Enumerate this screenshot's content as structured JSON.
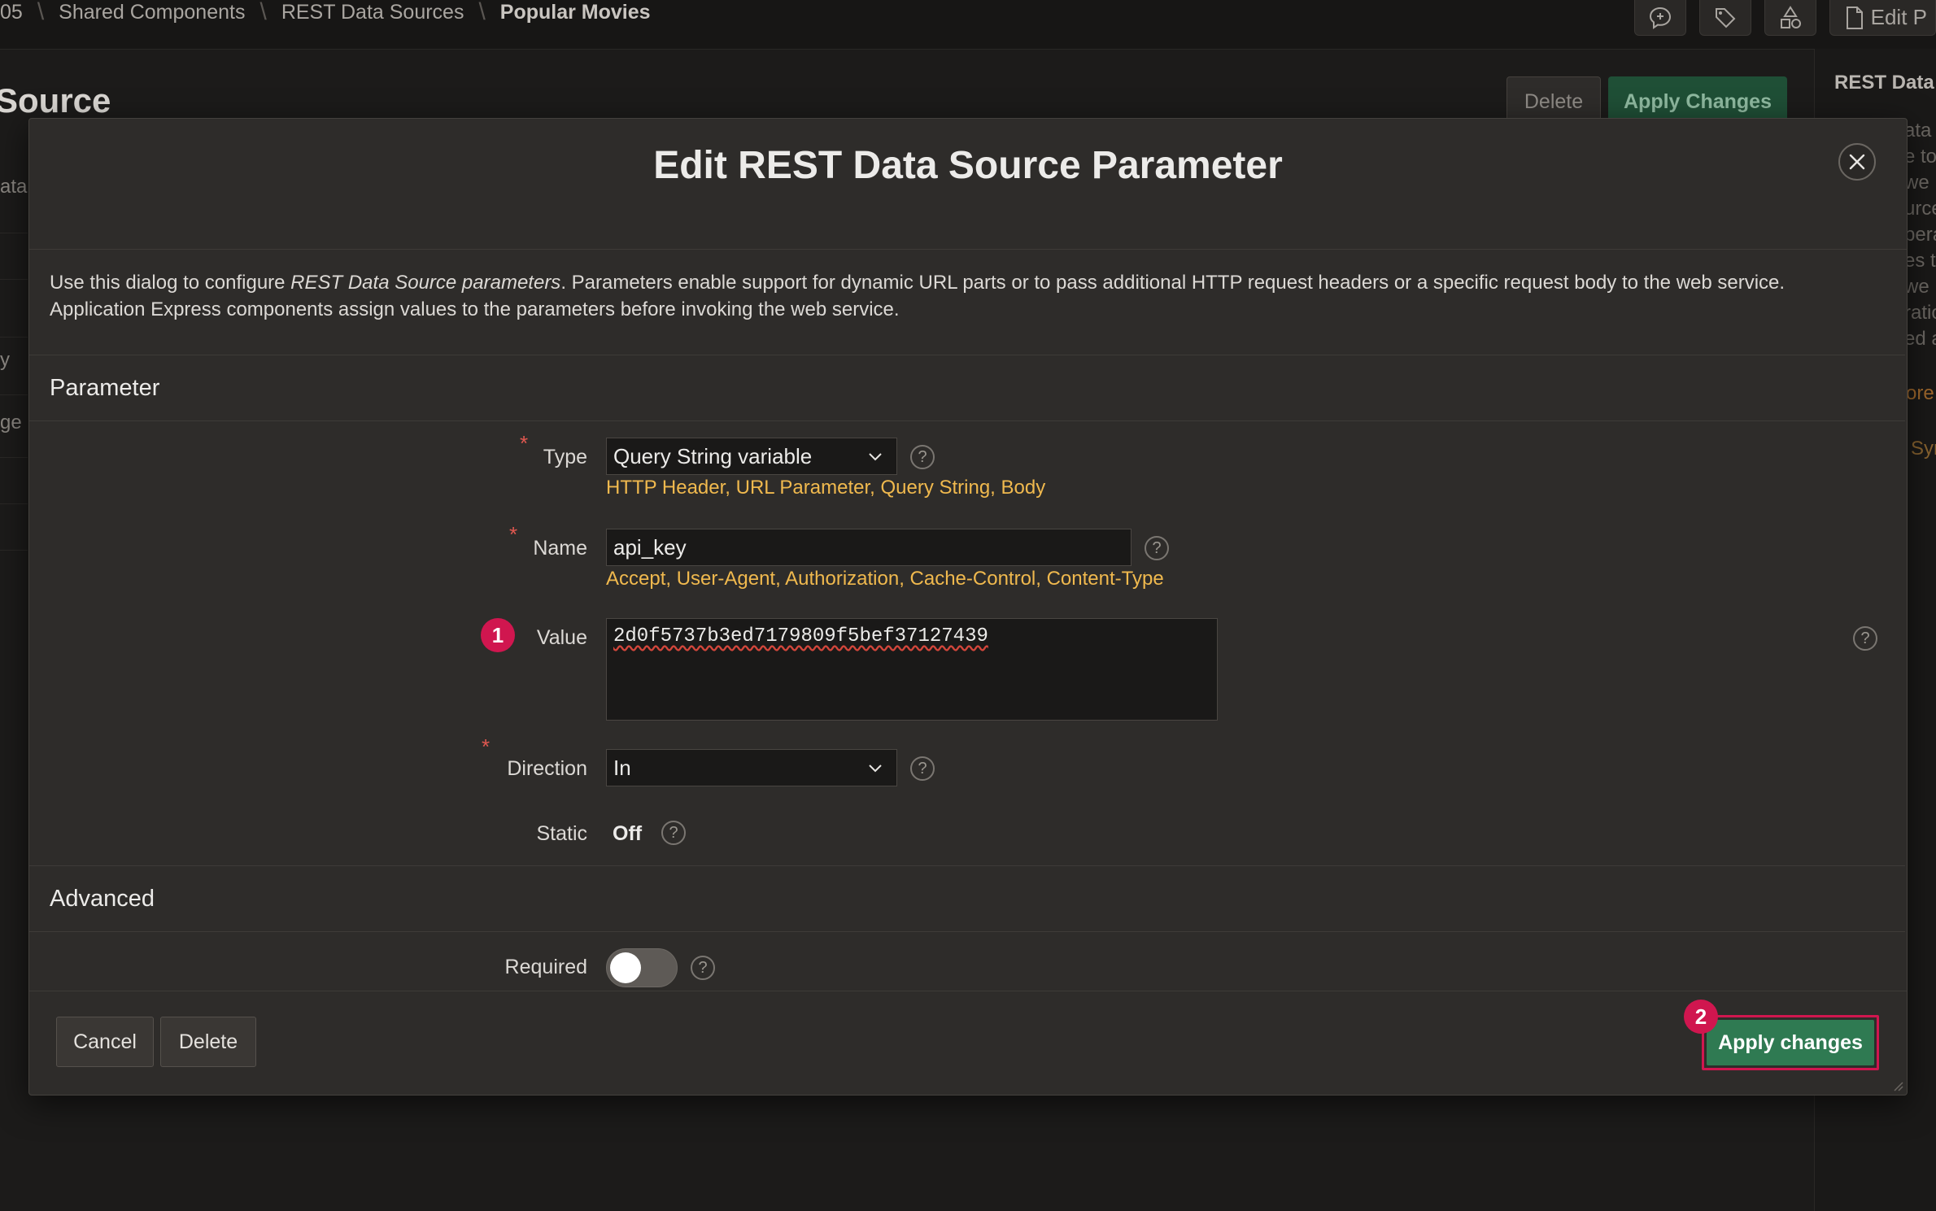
{
  "breadcrumbs": [
    "05",
    "Shared Components",
    "REST Data Sources",
    "Popular Movies"
  ],
  "topbar": {
    "edit_label": "Edit P"
  },
  "page": {
    "title": "Source",
    "delete_label": "Delete",
    "apply_label": "Apply Changes"
  },
  "left_partial": [
    "ata",
    "",
    "",
    "y",
    "ge",
    "",
    ""
  ],
  "right_panel": {
    "title": "REST Data",
    "lines": [
      "ata",
      "e to",
      "we",
      "urce",
      "pera",
      "es t",
      "we",
      "ratio",
      "ed a"
    ],
    "link": "ore",
    "link2": "Syn"
  },
  "dialog": {
    "title": "Edit REST Data Source Parameter",
    "intro_before": "Use this dialog to configure ",
    "intro_em": "REST Data Source parameters",
    "intro_after": ". Parameters enable support for dynamic URL parts or to pass additional HTTP request headers or a specific request body to the web service.",
    "intro_line2": "Application Express components assign values to the parameters before invoking the web service.",
    "section_parameter": "Parameter",
    "section_advanced": "Advanced",
    "fields": {
      "type_label": "Type",
      "type_value": "Query String variable",
      "type_hints": "HTTP Header, URL Parameter, Query String, Body",
      "name_label": "Name",
      "name_value": "api_key",
      "name_hints": "Accept, User-Agent, Authorization, Cache-Control, Content-Type",
      "value_label": "Value",
      "value_value": "2d0f5737b3ed7179809f5bef37127439",
      "direction_label": "Direction",
      "direction_value": "In",
      "static_label": "Static",
      "static_value": "Off",
      "required_label": "Required",
      "required_on": false
    },
    "required_marker": "*",
    "help_glyph": "?",
    "footer": {
      "cancel": "Cancel",
      "delete": "Delete",
      "apply": "Apply changes"
    }
  },
  "annotations": {
    "badge1": "1",
    "badge2": "2",
    "badge_color": "#d0164f"
  },
  "colors": {
    "accent_green": "#2f7a52",
    "hint_yellow": "#f0b94e",
    "required_red": "#e05850"
  }
}
